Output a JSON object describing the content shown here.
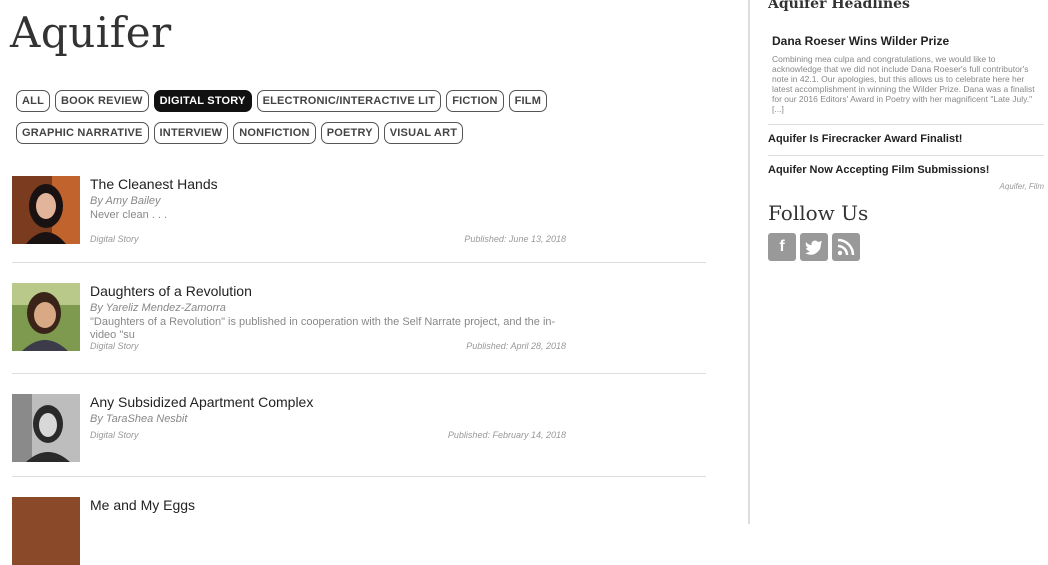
{
  "site": {
    "title": "Aquifer"
  },
  "filters": {
    "row1": [
      "ALL",
      "BOOK REVIEW",
      "DIGITAL STORY",
      "ELECTRONIC/INTERACTIVE LIT",
      "FICTION",
      "FILM"
    ],
    "row2": [
      "GRAPHIC NARRATIVE",
      "INTERVIEW",
      "NONFICTION",
      "POETRY",
      "VISUAL ART"
    ],
    "active": "DIGITAL STORY"
  },
  "articles": [
    {
      "title": "The Cleanest Hands",
      "author": "By Amy Bailey",
      "excerpt": "Never clean . . .",
      "category": "Digital Story",
      "published": "Published: June 13, 2018"
    },
    {
      "title": "Daughters of a Revolution",
      "author": "By Yareliz Mendez-Zamorra",
      "excerpt": "\"Daughters of a Revolution\" is published in cooperation with the Self Narrate project, and the in-video \"su",
      "category": "Digital Story",
      "published": "Published: April 28, 2018"
    },
    {
      "title": "Any Subsidized Apartment Complex",
      "author": "By TaraShea Nesbit",
      "excerpt": "",
      "category": "Digital Story",
      "published": "Published: February 14, 2018"
    },
    {
      "title": "Me and My Eggs",
      "author": "",
      "excerpt": "",
      "category": "",
      "published": ""
    }
  ],
  "sidebar": {
    "cut_heading": "Aquifer Headlines",
    "feature_title": "Dana Roeser Wins Wilder Prize",
    "feature_text": "Combining mea culpa and congratulations, we would like to acknowledge that we did not include Dana Roeser's full contributor's note in 42.1. Our apologies, but this allows us to celebrate here her latest accomplishment in winning the Wilder Prize. Dana was a finalist for our 2016 Editors' Award in Poetry with her magnificent \"Late July.\" [...]",
    "link1": "Aquifer Is Firecracker Award Finalist!",
    "link2": "Aquifer Now Accepting Film Submissions!",
    "link2_tag": "Aquifer, Film",
    "follow_title": "Follow Us",
    "social": [
      "f",
      "t",
      "rss"
    ]
  }
}
